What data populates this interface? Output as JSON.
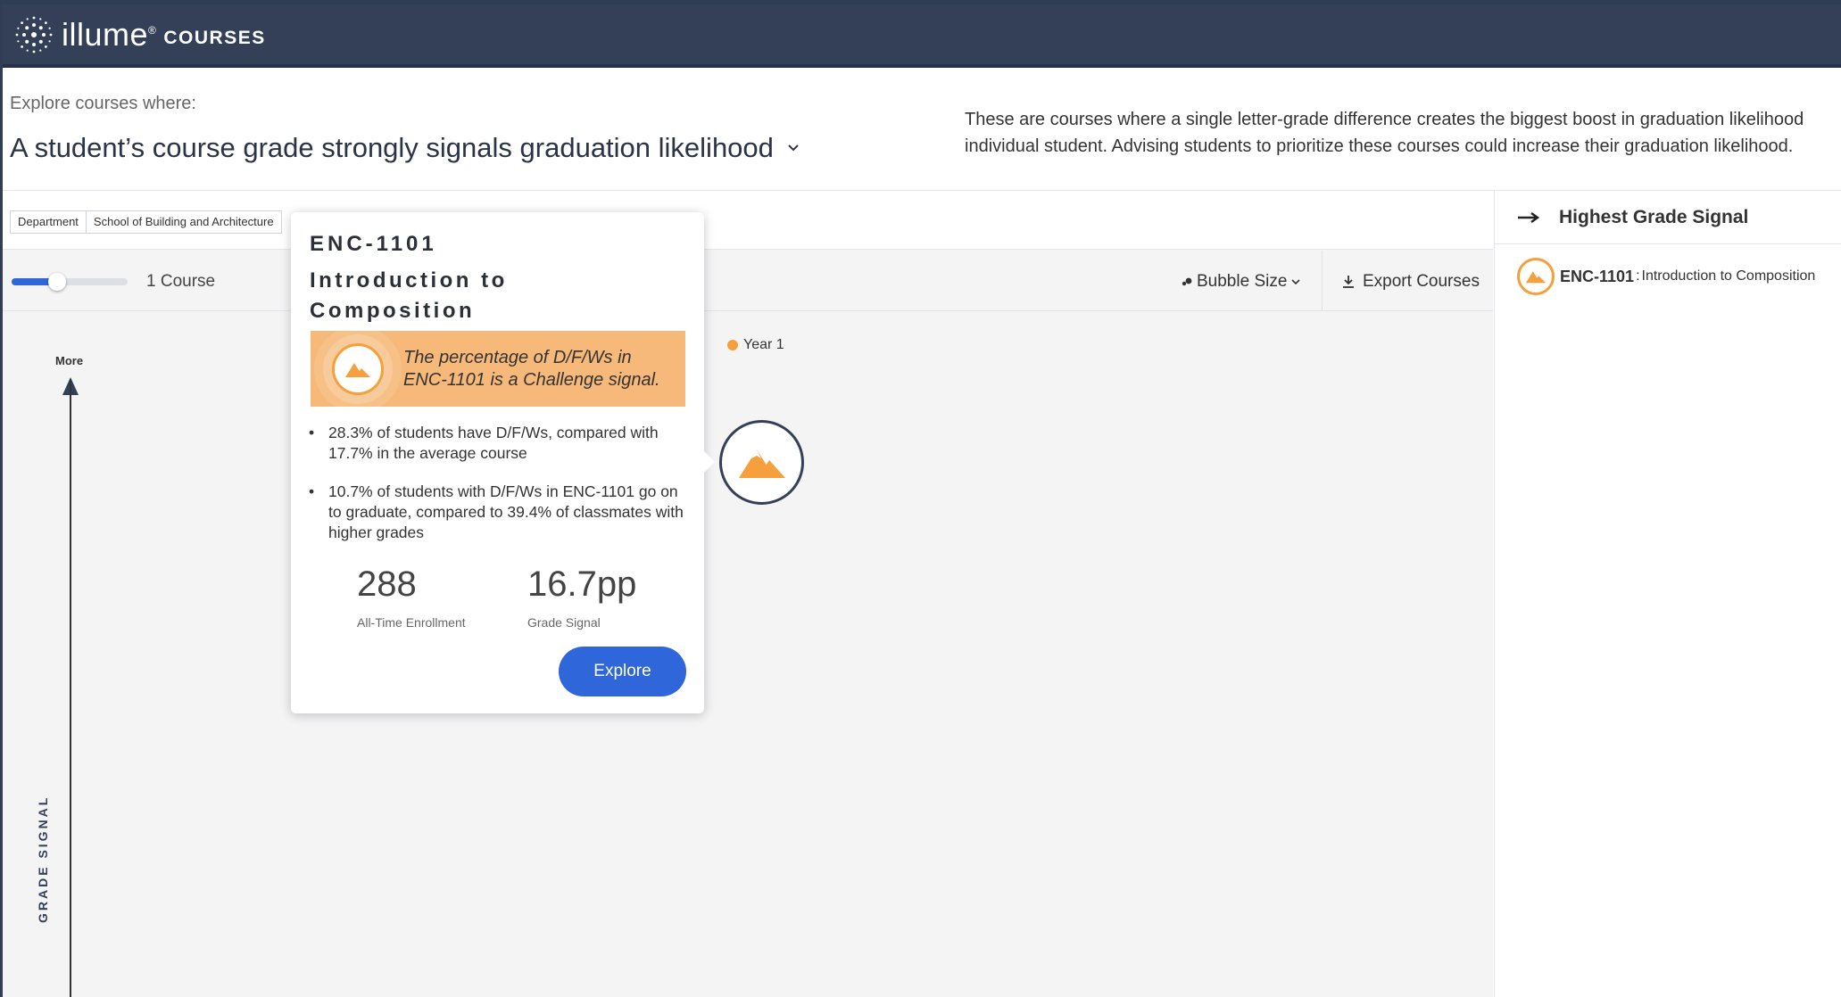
{
  "app": {
    "logo_name": "illume",
    "logo_sup": "®",
    "product": "COURSES"
  },
  "header": {
    "explore_label": "Explore courses where:",
    "question": "A student’s course grade strongly signals graduation likelihood",
    "description_line1": "These are courses where a single letter-grade difference creates the biggest boost in graduation likelihood",
    "description_line2": "individual student. Advising students to prioritize these courses could increase their graduation likelihood."
  },
  "filters": {
    "department_label": "Department",
    "department_value": "School of Building and Architecture"
  },
  "toolbar": {
    "course_count": "1 Course",
    "slider_value_fraction": 0.5,
    "bubble_size_label": "Bubble Size",
    "export_label": "Export Courses"
  },
  "plot": {
    "axis_more": "More",
    "axis_title": "GRADE SIGNAL",
    "legend_label": "Year 1",
    "legend_color": "#f5a03c"
  },
  "tooltip": {
    "code": "ENC-1101",
    "title": "Introduction to Composition",
    "signal_line1": "The percentage of D/F/Ws in",
    "signal_line2": "ENC-1101 is a Challenge signal.",
    "bullets": [
      "28.3% of students have D/F/Ws, compared with 17.7% in the average course",
      "10.7% of students with D/F/Ws in ENC-1101 go on to graduate, compared to 39.4% of classmates with higher grades"
    ],
    "enrollment_value": "288",
    "enrollment_label": "All-Time Enrollment",
    "signal_value": "16.7pp",
    "signal_label": "Grade Signal",
    "explore_button": "Explore"
  },
  "right_panel": {
    "title": "Highest Grade Signal",
    "items": [
      {
        "code": "ENC-1101",
        "separator": " : ",
        "name": "Introduction to Composition"
      }
    ]
  },
  "colors": {
    "topbar": "#344058",
    "accent_blue": "#2f66d9",
    "challenge_orange": "#f5a03c",
    "signal_bg": "#f7b97a"
  }
}
